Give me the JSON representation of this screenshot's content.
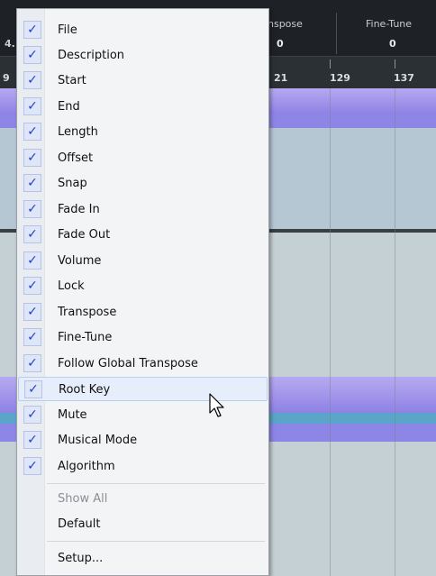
{
  "header": {
    "partial_left_label": "4.",
    "columns": [
      {
        "label": "nspose",
        "value": "0"
      },
      {
        "label": "Fine-Tune",
        "value": "0"
      }
    ]
  },
  "ruler": {
    "partial_left": "9",
    "marks": [
      "21",
      "129",
      "137"
    ]
  },
  "menu": {
    "items": [
      {
        "label": "File",
        "checked": true
      },
      {
        "label": "Description",
        "checked": true
      },
      {
        "label": "Start",
        "checked": true
      },
      {
        "label": "End",
        "checked": true
      },
      {
        "label": "Length",
        "checked": true
      },
      {
        "label": "Offset",
        "checked": true
      },
      {
        "label": "Snap",
        "checked": true
      },
      {
        "label": "Fade In",
        "checked": true
      },
      {
        "label": "Fade Out",
        "checked": true
      },
      {
        "label": "Volume",
        "checked": true
      },
      {
        "label": "Lock",
        "checked": true
      },
      {
        "label": "Transpose",
        "checked": true
      },
      {
        "label": "Fine-Tune",
        "checked": true
      },
      {
        "label": "Follow Global Transpose",
        "checked": true
      },
      {
        "label": "Root Key",
        "checked": true,
        "hovered": true
      },
      {
        "label": "Mute",
        "checked": true
      },
      {
        "label": "Musical Mode",
        "checked": true
      },
      {
        "label": "Algorithm",
        "checked": true
      }
    ],
    "show_all": "Show All",
    "default": "Default",
    "setup": "Setup...",
    "check_glyph": "✓"
  },
  "colors": {
    "check": "#1f43c6",
    "hover": "#e6eefb",
    "lane_purple": "#8f82e4",
    "header_bg": "#1e2226"
  }
}
